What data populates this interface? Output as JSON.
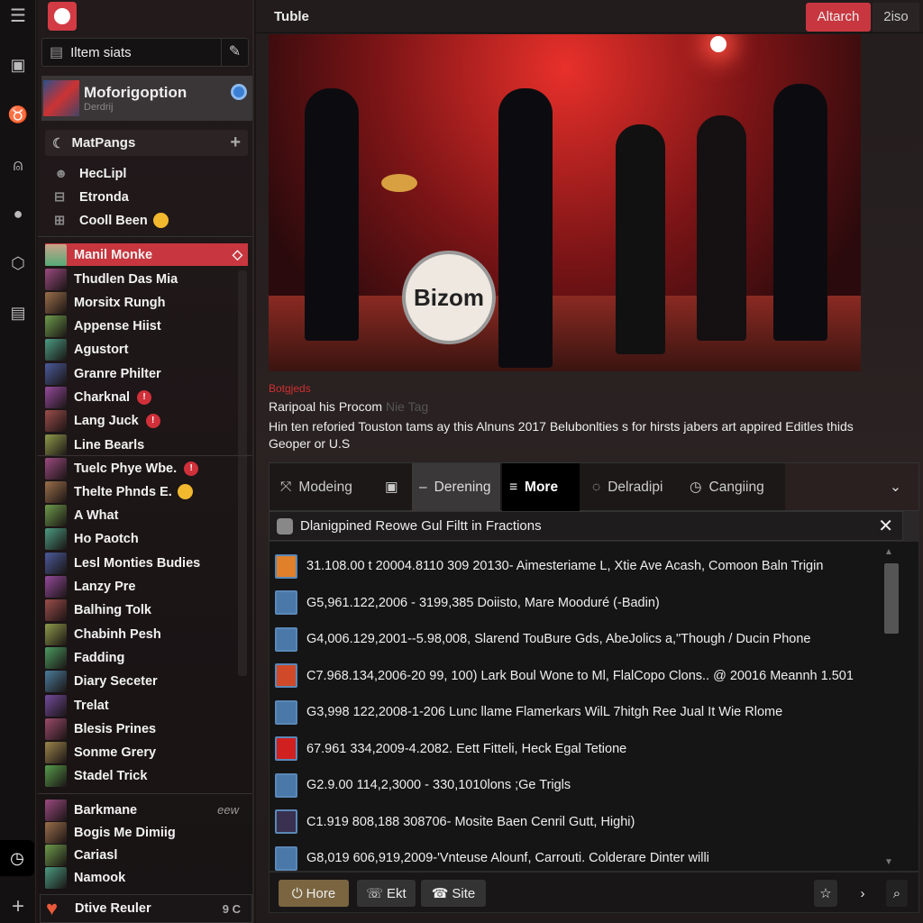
{
  "header": {
    "title": "Tuble",
    "attach_label": "Altarch",
    "second_label": "2iso"
  },
  "sidebar": {
    "search_label": "Iltem siats",
    "profile": {
      "name": "Moforigoption",
      "subtitle": "Derdrij"
    },
    "group": {
      "title": "MatPangs"
    },
    "group_items": [
      {
        "label": "HecLipl"
      },
      {
        "label": "Etronda"
      },
      {
        "label": "Cooll Been"
      }
    ],
    "selected": {
      "label": "Manil Monke"
    },
    "section1": [
      {
        "label": "Thudlen Das Mia"
      },
      {
        "label": "Morsitx Rungh"
      },
      {
        "label": "Appense Hiist"
      },
      {
        "label": "Agustort"
      },
      {
        "label": "Granre Philter"
      },
      {
        "label": "Charknal",
        "badge": "!"
      },
      {
        "label": "Lang Juck",
        "badge": "!"
      },
      {
        "label": "Line Bearls"
      }
    ],
    "section2": [
      {
        "label": "Tuelc Phye Wbe.",
        "badge": "!"
      },
      {
        "label": "Thelte Phnds E."
      },
      {
        "label": "A  What"
      },
      {
        "label": "Ho Paotch"
      },
      {
        "label": "Lesl Monties Budies"
      },
      {
        "label": "Lanzy Pre"
      },
      {
        "label": "Balhing Tolk"
      },
      {
        "label": "Chabinh Pesh"
      },
      {
        "label": "Fadding"
      },
      {
        "label": "Diary Seceter"
      },
      {
        "label": "Trelat"
      },
      {
        "label": "Blesis Prines"
      },
      {
        "label": "Sonme Grery"
      },
      {
        "label": "Stadel Trick"
      }
    ],
    "section3": [
      {
        "label": "Barkmane",
        "meta": "eew"
      },
      {
        "label": "Bogis Me Dimiig"
      },
      {
        "label": "Cariasl"
      },
      {
        "label": "Namook"
      }
    ],
    "footer": {
      "label": "Dtive Reuler",
      "meta": "9 C"
    }
  },
  "media": {
    "drum_logo": "Bizom"
  },
  "post": {
    "tag": "Botgjeds",
    "title": "Raripoal his Procom",
    "title_meta": "Nie Tag",
    "description": "Hin ten reforied Touston tams ay this Alnuns 2017 Belubonlties s for hirsts jabers art appired Editles thids Geoper or U.S"
  },
  "tabs": [
    {
      "label": "Modeing",
      "icon": "cross-arrows-icon"
    },
    {
      "label": "",
      "icon": "device-icon"
    },
    {
      "label": "Derening",
      "icon": "dash-icon",
      "active": true
    },
    {
      "label": "More",
      "icon": "menu-icon",
      "selected": true
    },
    {
      "label": "Delradipi",
      "icon": "leaf-icon"
    },
    {
      "label": "Cangiing",
      "icon": "clock-icon"
    }
  ],
  "panel": {
    "title": "Dlanigpined Reowe Gul Filtt in Fractions",
    "items": [
      {
        "text": "31.108.00 t 20004.8110 309 20130- Aimesteriame L, Xtie Ave Acash, Comoon Baln Trigin",
        "color": "#e0802a"
      },
      {
        "text": "G5,961.122,2006 - 3199,385 Doiisto, Mare Mooduré (-Badin)",
        "color": "#4a78a8"
      },
      {
        "text": "G4,006.129,2001--5.98,008, Slarend TouBure Gds, AbeJolics a,\"Though / Ducin Phone",
        "color": "#4a78a8"
      },
      {
        "text": "C7.968.134,2006-20 99, 100) Lark Boul Wone to Ml, FlalCopo Clons.. @ 20016 Meannh 1.501",
        "color": "#d04a2a"
      },
      {
        "text": "G3,998 122,2008-1-206 Lunc llame Flamerkars WilL 7hitgh Ree Jual It Wie Rlome",
        "color": "#4a78a8"
      },
      {
        "text": "67.961 334,2009-4.2082. Eett Fitteli, Heck Egal Tetione",
        "color": "#d02020"
      },
      {
        "text": "G2.9.00 114,2,3000 - 330,1010lons ;Ge Trigls",
        "color": "#4a78a8"
      },
      {
        "text": "C1.919 808,188 308706- Mosite Baen Cenril Gutt, Highi)",
        "color": "#3a3050"
      },
      {
        "text": "G8,019 606,919,2009-'Vnteuse Alounf, Carrouti. Colderare Dinter willi",
        "color": "#4a78a8"
      }
    ]
  },
  "footer": {
    "buttons": [
      {
        "label": "Hore"
      },
      {
        "label": "Ekt"
      },
      {
        "label": "Site"
      }
    ]
  },
  "colors": {
    "accent": "#c8373f",
    "hore": "#7a6540"
  }
}
